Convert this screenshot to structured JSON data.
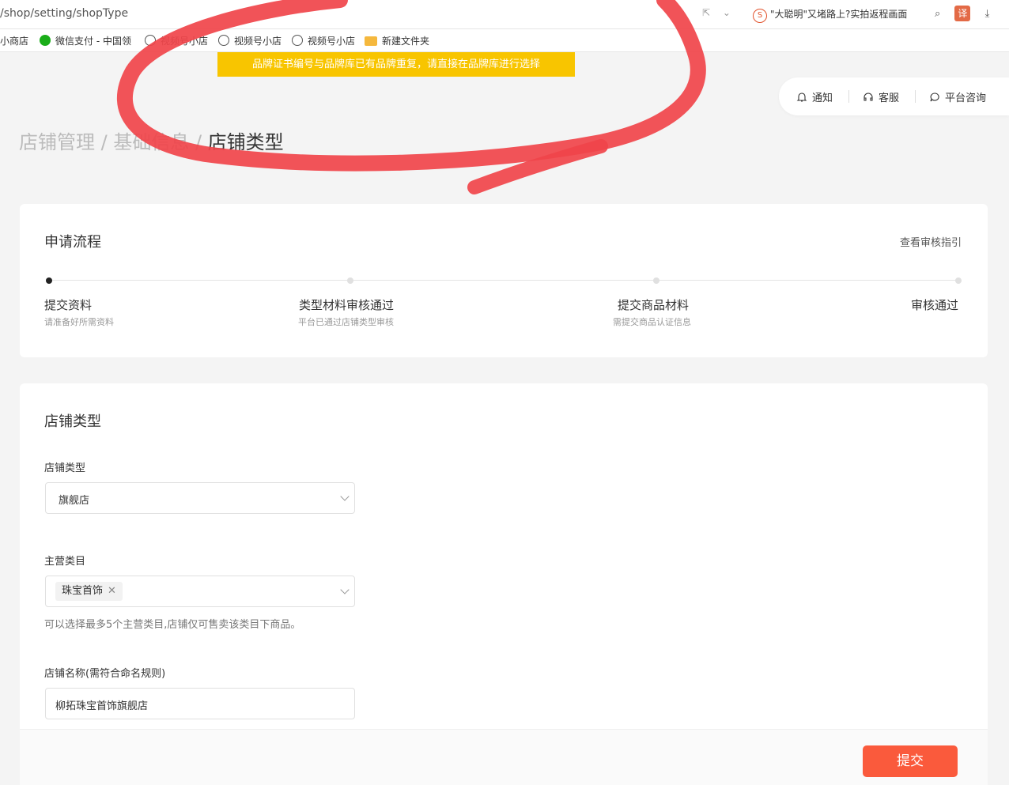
{
  "browser": {
    "url": "/shop/setting/shopType",
    "news_text": "\"大聪明\"又堵路上?实拍返程画面",
    "search_icon": "search-icon",
    "translate_label": "译"
  },
  "bookmarks": [
    {
      "label": "小商店",
      "icon": "none"
    },
    {
      "label": "微信支付 - 中国领",
      "icon": "wechat-icon"
    },
    {
      "label": "视频号小店",
      "icon": "globe-icon"
    },
    {
      "label": "视频号小店",
      "icon": "globe-icon"
    },
    {
      "label": "视频号小店",
      "icon": "globe-icon"
    },
    {
      "label": "新建文件夹",
      "icon": "folder-icon"
    }
  ],
  "toast": {
    "message": "品牌证书编号与品牌库已有品牌重复，请直接在品牌库进行选择"
  },
  "topbar": {
    "notify": "通知",
    "service": "客服",
    "consult": "平台咨询"
  },
  "breadcrumb": {
    "level1": "店铺管理",
    "sep1": " / ",
    "level2": "基础信息",
    "sep2": " / ",
    "current": "店铺类型"
  },
  "process": {
    "title": "申请流程",
    "guide_link": "查看审核指引",
    "steps": [
      {
        "title": "提交资料",
        "sub": "请准备好所需资料"
      },
      {
        "title": "类型材料审核通过",
        "sub": "平台已通过店铺类型审核"
      },
      {
        "title": "提交商品材料",
        "sub": "需提交商品认证信息"
      },
      {
        "title": "审核通过",
        "sub": ""
      }
    ],
    "current_step": 1
  },
  "form": {
    "title": "店铺类型",
    "shop_type_label": "店铺类型",
    "shop_type_value": "旗舰店",
    "category_label": "主营类目",
    "category_tags": [
      "珠宝首饰"
    ],
    "category_hint": "可以选择最多5个主营类目,店铺仅可售卖该类目下商品。",
    "shop_name_label": "店铺名称(需符合命名规则)",
    "shop_name_value": "柳拓珠宝首饰旗舰店",
    "submit_label": "提交"
  },
  "colors": {
    "accent": "#fa5a3c",
    "toast": "#f8c500",
    "annotation": "#f0444a"
  }
}
